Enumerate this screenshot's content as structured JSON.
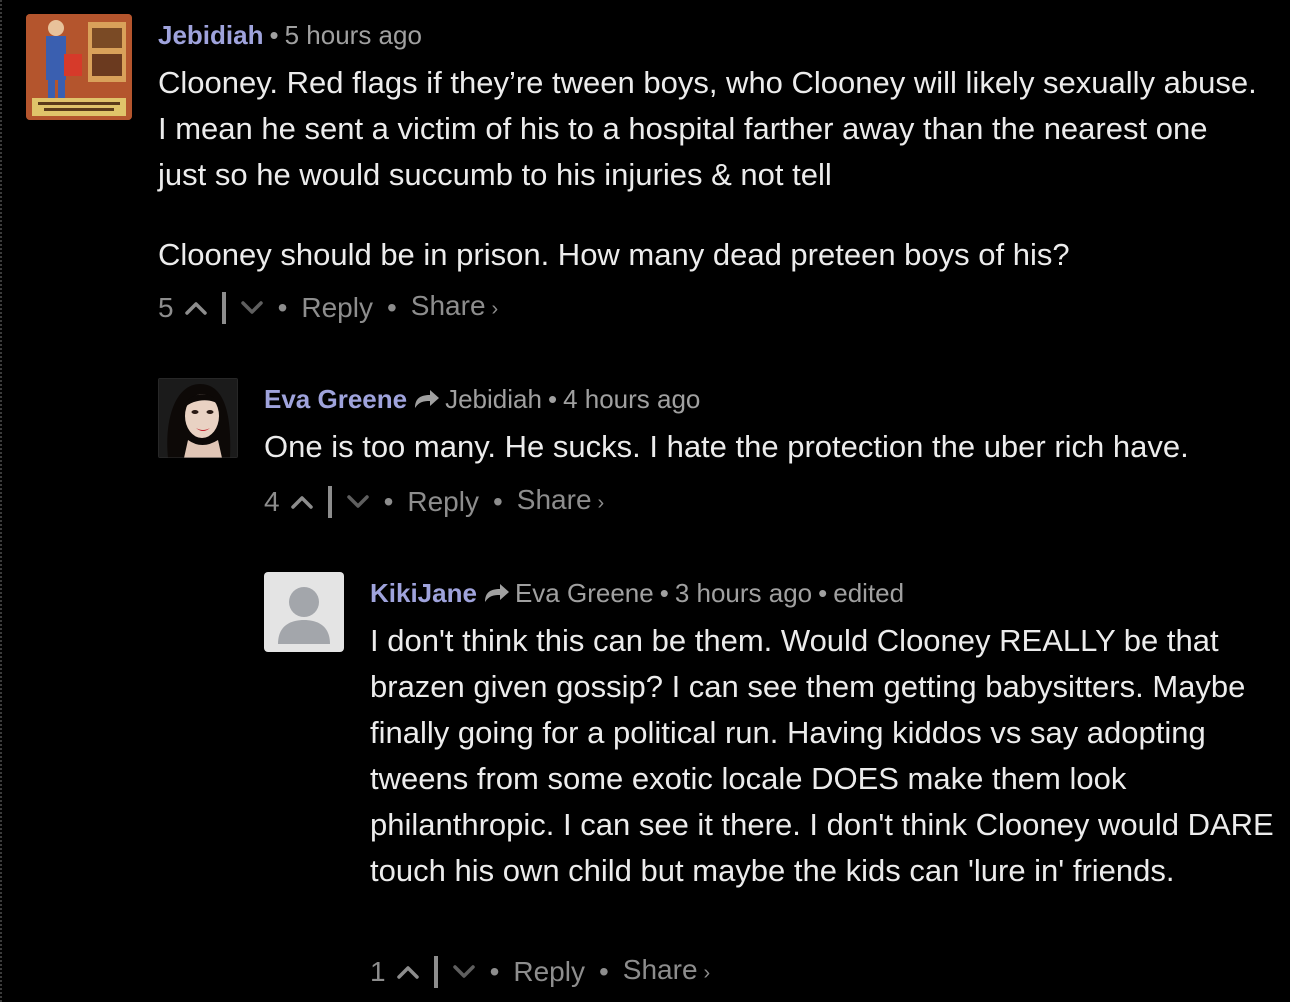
{
  "comments": [
    {
      "author": "Jebidiah",
      "reply_to": "",
      "time": "5 hours ago",
      "edited": "",
      "paragraphs": [
        "Clooney. Red flags if they’re tween boys, who Clooney will likely sexually abuse. I mean he sent a victim of his to a hospital farther away than the nearest one just so he would succumb to his injuries & not tell",
        "Clooney should be in prison. How many dead preteen boys of his?"
      ],
      "upvotes": "5",
      "reply_label": "Reply",
      "share_label": "Share",
      "avatar_icon": "poster-avatar-icon"
    },
    {
      "author": "Eva Greene",
      "reply_to": "Jebidiah",
      "time": "4 hours ago",
      "edited": "",
      "paragraphs": [
        "One is too many. He sucks. I hate the protection the uber rich have."
      ],
      "upvotes": "4",
      "reply_label": "Reply",
      "share_label": "Share",
      "avatar_icon": "portrait-avatar-icon"
    },
    {
      "author": "KikiJane",
      "reply_to": "Eva Greene",
      "time": "3 hours ago",
      "edited": "edited",
      "paragraphs": [
        "I don't think this can be them. Would Clooney REALLY be that brazen given gossip? I can see them getting babysitters. Maybe finally going for a political run. Having kiddos vs say adopting tweens from some exotic locale DOES make them look philanthropic. I can see it there. I don't think Clooney would DARE touch his own child but maybe the kids can 'lure in' friends."
      ],
      "upvotes": "1",
      "reply_label": "Reply",
      "share_label": "Share",
      "avatar_icon": "default-user-avatar-icon"
    }
  ],
  "colors": {
    "background": "#000000",
    "author": "#9fa3dc",
    "meta": "#a0a0a0",
    "body": "#ececec",
    "actions": "#8d8d8d"
  }
}
